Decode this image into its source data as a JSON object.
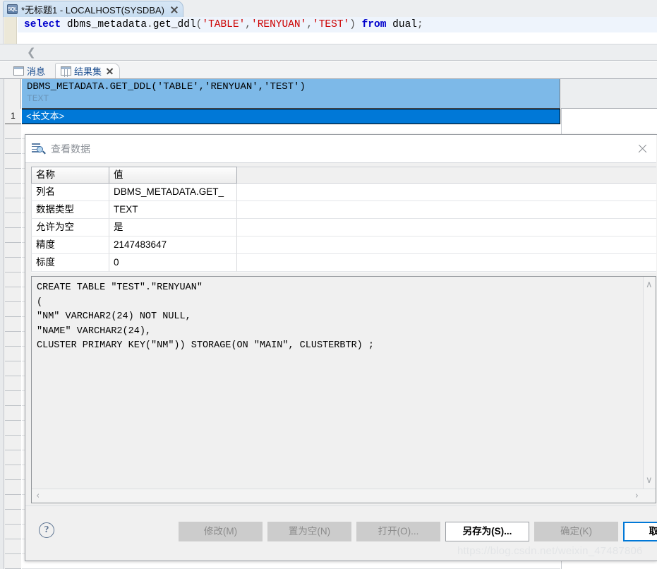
{
  "window_tab": {
    "icon": "sql-file-icon",
    "badge": "SQL",
    "title": "*无标题1 - LOCALHOST(SYSDBA)",
    "close": "close-icon"
  },
  "sql_editor": {
    "tokens": [
      {
        "t": "select",
        "k": "kw"
      },
      {
        "t": " dbms_metadata",
        "k": "pl"
      },
      {
        "t": ".",
        "k": "punc"
      },
      {
        "t": "get_ddl",
        "k": "pl"
      },
      {
        "t": "(",
        "k": "punc"
      },
      {
        "t": "'TABLE'",
        "k": "str"
      },
      {
        "t": ",",
        "k": "punc"
      },
      {
        "t": "'RENYUAN'",
        "k": "str"
      },
      {
        "t": ",",
        "k": "punc"
      },
      {
        "t": "'TEST'",
        "k": "str"
      },
      {
        "t": ")",
        "k": "punc"
      },
      {
        "t": " ",
        "k": "pl"
      },
      {
        "t": "from",
        "k": "kw"
      },
      {
        "t": " dual",
        "k": "pl"
      },
      {
        "t": ";",
        "k": "punc"
      }
    ],
    "full_text": "select dbms_metadata.get_ddl('TABLE','RENYUAN','TEST') from dual;"
  },
  "collapse_strip": {
    "chevron": "❮"
  },
  "result_tabs": [
    {
      "label": "消息",
      "icon": "message-icon",
      "active": false,
      "closable": false
    },
    {
      "label": "结果集",
      "icon": "grid-icon",
      "active": true,
      "closable": true
    }
  ],
  "result_grid": {
    "column_name": "DBMS_METADATA.GET_DDL('TABLE','RENYUAN','TEST')",
    "column_type": "TEXT",
    "row_number": "1",
    "row_value": "<长文本>",
    "header_color": "#7db9e8",
    "selection_color": "#0078d7"
  },
  "dialog": {
    "title": "查看数据",
    "title_icon": "view-data-magnifier-icon",
    "close_icon": "close-icon",
    "property_table": {
      "headers": [
        "名称",
        "值"
      ],
      "rows": [
        {
          "name": "列名",
          "value": "DBMS_METADATA.GET_"
        },
        {
          "name": "数据类型",
          "value": "TEXT"
        },
        {
          "name": "允许为空",
          "value": "是"
        },
        {
          "name": "精度",
          "value": "2147483647"
        },
        {
          "name": "标度",
          "value": "0"
        }
      ]
    },
    "ddl_text": "CREATE TABLE \"TEST\".\"RENYUAN\"\n(\n\"NM\" VARCHAR2(24) NOT NULL,\n\"NAME\" VARCHAR2(24),\nCLUSTER PRIMARY KEY(\"NM\")) STORAGE(ON \"MAIN\", CLUSTERBTR) ;",
    "scrollbars": {
      "up": "∧",
      "down": "∨",
      "left": "‹",
      "right": "›"
    },
    "help_label": "?",
    "buttons": [
      {
        "label": "修改(M)",
        "state": "disabled"
      },
      {
        "label": "置为空(N)",
        "state": "disabled"
      },
      {
        "label": "打开(O)...",
        "state": "disabled"
      },
      {
        "label": "另存为(S)...",
        "state": "enabled"
      },
      {
        "label": "确定(K)",
        "state": "disabled"
      },
      {
        "label": "取消(C)",
        "state": "focused"
      }
    ]
  },
  "watermark": "https://blog.csdn.net/weixin_47487806"
}
